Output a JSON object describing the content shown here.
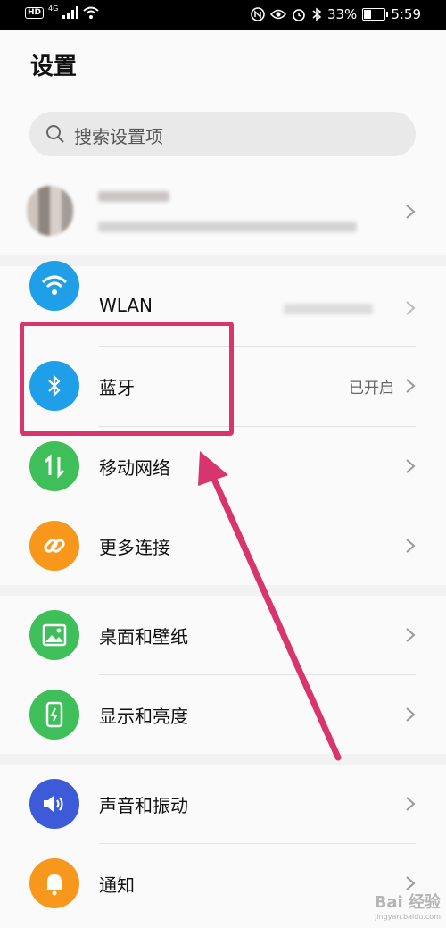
{
  "status_bar": {
    "hd": "HD",
    "network": "4G",
    "battery_percent": "33%",
    "battery_level": 0.33,
    "time": "5:59"
  },
  "page": {
    "title": "设置"
  },
  "search": {
    "placeholder": "搜索设置项"
  },
  "rows": {
    "wlan": {
      "label": "WLAN",
      "icon": "wifi-icon",
      "color": "#1e9fe8"
    },
    "bluetooth": {
      "label": "蓝牙",
      "value": "已开启",
      "icon": "bluetooth-icon",
      "color": "#1e9fe8"
    },
    "mobile_network": {
      "label": "移动网络",
      "icon": "mobile-data-icon",
      "color": "#3fbf5a"
    },
    "more_connections": {
      "label": "更多连接",
      "icon": "link-icon",
      "color": "#f7971c"
    },
    "wallpaper": {
      "label": "桌面和壁纸",
      "icon": "image-icon",
      "color": "#3fbf5a"
    },
    "display": {
      "label": "显示和亮度",
      "icon": "phone-brightness-icon",
      "color": "#3fbf5a"
    },
    "sound": {
      "label": "声音和振动",
      "icon": "speaker-icon",
      "color": "#3d5bd9"
    },
    "notifications": {
      "label": "通知",
      "icon": "bell-icon",
      "color": "#f7971c"
    }
  },
  "annotation": {
    "highlight_color": "#d8356f"
  },
  "watermark": {
    "text": "Bai 经验",
    "url": "jingyan.baidu.com"
  }
}
